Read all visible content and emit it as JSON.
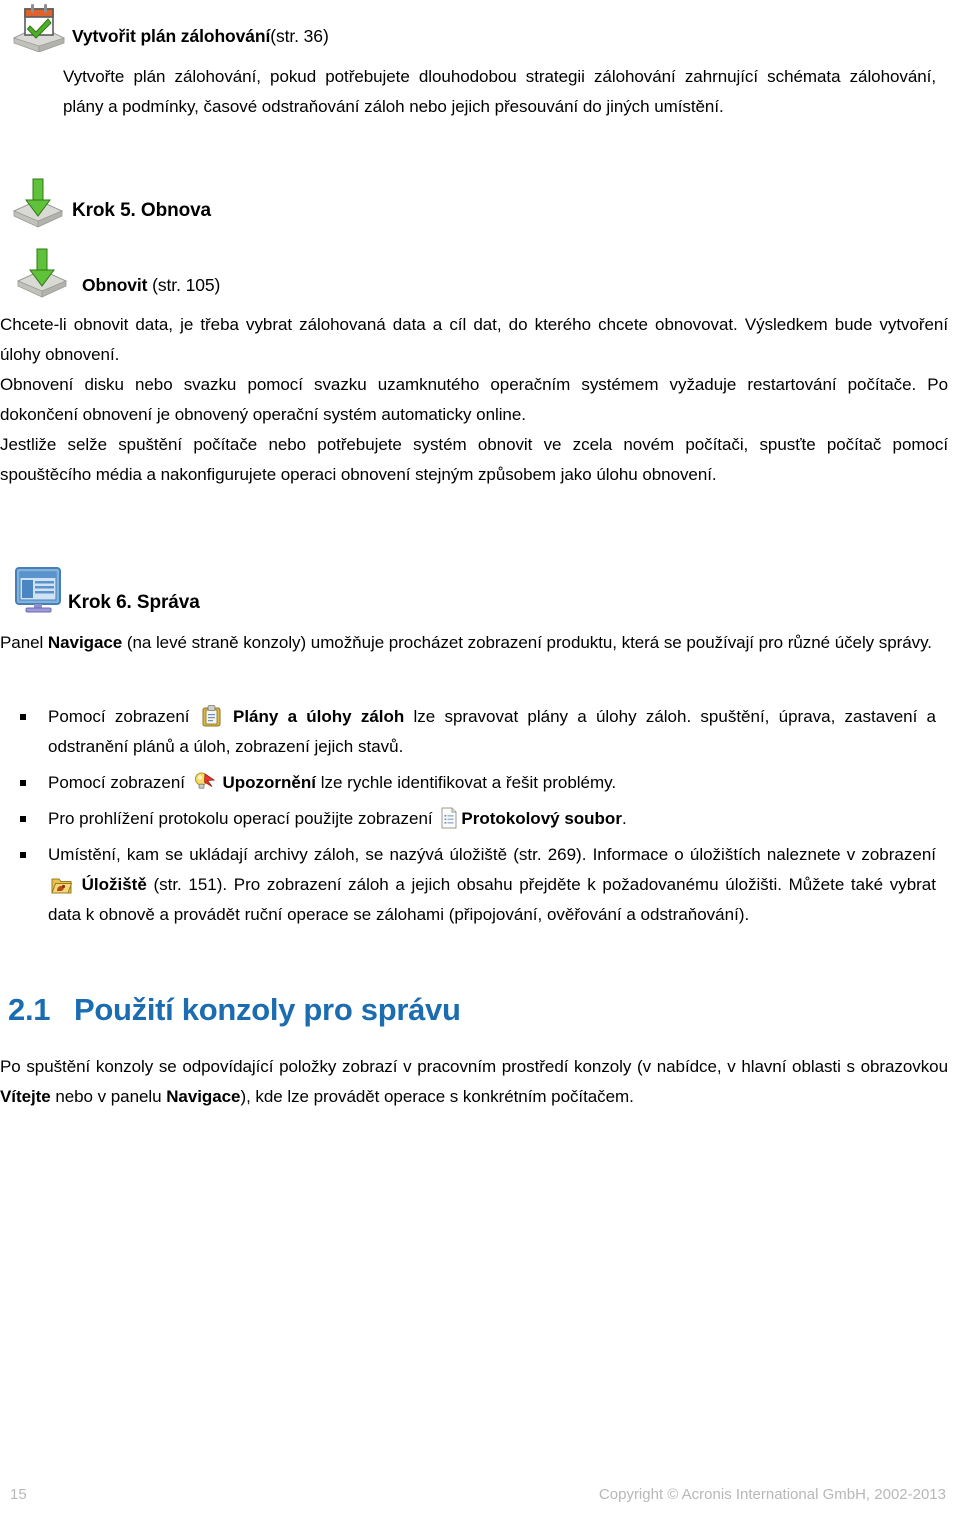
{
  "document": {
    "language": "cs",
    "accent_color": "#1b6cb0",
    "footer_color": "#b8b8b8"
  },
  "sections": {
    "create_backup_plan": {
      "icon": "calendar-check-disk-icon",
      "title": "Vytvořit plán zálohování",
      "page_ref": "(str.    36)",
      "body": "Vytvořte plán zálohování, pokud potřebujete dlouhodobou strategii zálohování zahrnující schémata zálohování, plány a podmínky, časové odstraňování záloh nebo jejich přesouvání do jiných umístění."
    },
    "step5": {
      "icon": "green-down-arrow-disk-icon",
      "heading": "Krok 5. Obnova",
      "recover": {
        "icon": "green-down-arrow-disk-icon",
        "title": "Obnovit",
        "page_ref": "(str.    105)",
        "paragraphs": [
          "Chcete-li obnovit data, je třeba vybrat zálohovaná data a cíl dat, do kterého chcete obnovovat. Výsledkem bude vytvoření úlohy obnovení.",
          "Obnovení disku nebo svazku pomocí svazku uzamknutého operačním systémem vyžaduje restartování počítače. Po dokončení obnovení je obnovený operační systém automaticky online.",
          "Jestliže selže spuštění počítače nebo potřebujete systém obnovit ve zcela novém počítači, spusťte počítač pomocí spouštěcího média a nakonfigurujete operaci obnovení stejným způsobem jako úlohu obnovení."
        ]
      }
    },
    "step6": {
      "icon": "console-monitor-icon",
      "heading": "Krok 6. Správa",
      "intro_parts": {
        "p1": "Panel ",
        "bold1": "Navigace",
        "p2": " (na levé straně konzoly) umožňuje procházet zobrazení produktu, která se používají pro různé účely správy."
      },
      "bullets": [
        {
          "icon": "clipboard-icon",
          "pre": "Pomocí zobrazení",
          "bold": "Plány a úlohy záloh",
          "post": "lze spravovat plány a úlohy záloh. spuštění, úprava, zastavení a odstranění plánů a úloh, zobrazení jejich stavů."
        },
        {
          "icon": "lightbulb-alert-icon",
          "pre": "Pomocí zobrazení",
          "bold": "Upozornění",
          "post": "lze rychle identifikovat a řešit problémy."
        },
        {
          "icon": "log-file-icon",
          "pre": "Pro prohlížení protokolu operací použijte zobrazení",
          "bold": "Protokolový soubor",
          "post": "."
        },
        {
          "icon": "vault-folder-icon",
          "pre_a": "Umístění, kam se ukládají archivy záloh, se nazývá úložiště (str.    269). Informace o úložištích naleznete v zobrazení",
          "bold": "Úložiště",
          "post_a": "(str.    151). Pro zobrazení záloh a jejich obsahu přejděte k požadovanému úložišti. Můžete také vybrat data k obnově a provádět ruční operace se zálohami (připojování, ověřování a odstraňování)."
        }
      ]
    },
    "section_21": {
      "number": "2.1",
      "title": "Použití konzoly pro správu",
      "paragraph_parts": {
        "p1": "Po spuštění konzoly se odpovídající položky zobrazí v pracovním prostředí konzoly (v nabídce, v hlavní oblasti s obrazovkou ",
        "bold1": "Vítejte",
        "p2": " nebo v panelu ",
        "bold2": "Navigace",
        "p3": "), kde lze provádět operace s konkrétním počítačem."
      }
    }
  },
  "footer": {
    "page_number": "15",
    "copyright": "Copyright ©  Acronis International GmbH, 2002-2013"
  }
}
